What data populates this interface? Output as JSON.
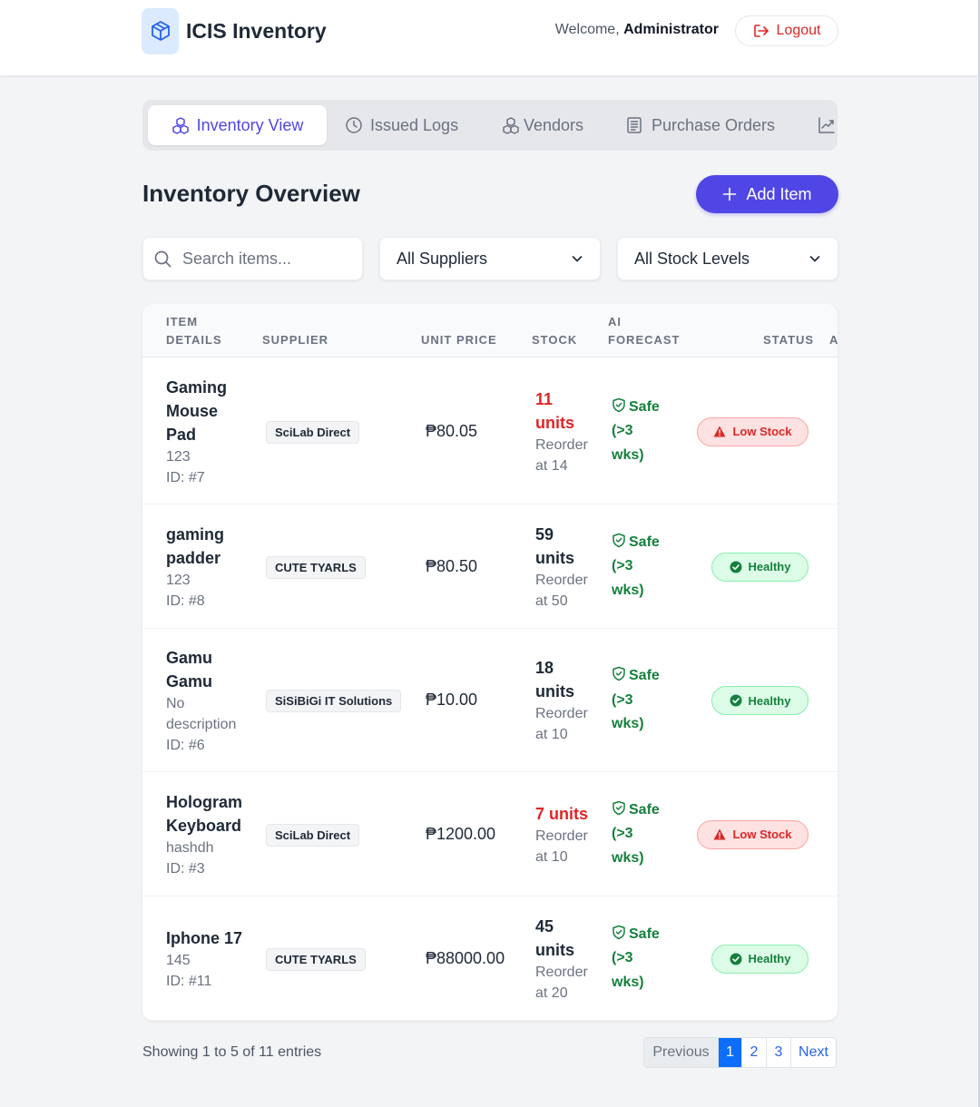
{
  "header": {
    "title": "ICIS Inventory",
    "welcome_prefix": "Welcome,",
    "user": "Administrator",
    "logout_label": "Logout"
  },
  "tabs": [
    {
      "label": "Inventory View",
      "icon": "cubes-icon",
      "active": true
    },
    {
      "label": "Issued Logs",
      "icon": "clock-icon"
    },
    {
      "label": "Vendors",
      "icon": "cubes-icon"
    },
    {
      "label": "Purchase Orders",
      "icon": "document-icon"
    },
    {
      "label": "",
      "icon": "chart-line-icon"
    }
  ],
  "overview": {
    "title": "Inventory Overview",
    "add_label": "Add Item"
  },
  "filters": {
    "search_placeholder": "Search items...",
    "supplier_select": "All Suppliers",
    "stock_select": "All Stock Levels"
  },
  "table": {
    "headers": {
      "item_1": "ITEM",
      "item_2": "DETAILS",
      "supplier": "SUPPLIER",
      "unit_price": "UNIT PRICE",
      "stock": "STOCK",
      "ai_1": "AI",
      "ai_2": "FORECAST",
      "status": "STATUS",
      "actions": "A"
    },
    "rows": [
      {
        "name_lines": [
          "Gaming",
          "Mouse",
          "Pad"
        ],
        "desc_lines": [
          "123"
        ],
        "id": "ID: #7",
        "supplier": "SciLab Direct",
        "price": "₱80.05",
        "stock_lines": [
          "11",
          "units"
        ],
        "stock_low": true,
        "reorder_lines": [
          "Reorder",
          "at 14"
        ],
        "forecast_lines": [
          "Safe",
          "(>3",
          "wks)"
        ],
        "status": "Low Stock",
        "status_kind": "low"
      },
      {
        "name_lines": [
          "gaming",
          "padder"
        ],
        "desc_lines": [
          "123"
        ],
        "id": "ID: #8",
        "supplier": "CUTE TYARLS",
        "price": "₱80.50",
        "stock_lines": [
          "59",
          "units"
        ],
        "stock_low": false,
        "reorder_lines": [
          "Reorder",
          "at 50"
        ],
        "forecast_lines": [
          "Safe",
          "(>3",
          "wks)"
        ],
        "status": "Healthy",
        "status_kind": "ok"
      },
      {
        "name_lines": [
          "Gamu",
          "Gamu"
        ],
        "desc_lines": [
          "No",
          "description"
        ],
        "id": "ID: #6",
        "supplier": "SiSiBiGi IT Solutions",
        "price": "₱10.00",
        "stock_lines": [
          "18",
          "units"
        ],
        "stock_low": false,
        "reorder_lines": [
          "Reorder",
          "at 10"
        ],
        "forecast_lines": [
          "Safe",
          "(>3",
          "wks)"
        ],
        "status": "Healthy",
        "status_kind": "ok"
      },
      {
        "name_lines": [
          "Hologram",
          "Keyboard"
        ],
        "desc_lines": [
          "hashdh"
        ],
        "id": "ID: #3",
        "supplier": "SciLab Direct",
        "price": "₱1200.00",
        "stock_lines": [
          "7 units"
        ],
        "stock_low": true,
        "reorder_lines": [
          "Reorder",
          "at 10"
        ],
        "forecast_lines": [
          "Safe",
          "(>3",
          "wks)"
        ],
        "status": "Low Stock",
        "status_kind": "low"
      },
      {
        "name_lines": [
          "Iphone 17"
        ],
        "desc_lines": [
          "145"
        ],
        "id": "ID: #11",
        "supplier": "CUTE TYARLS",
        "price": "₱88000.00",
        "stock_lines": [
          "45",
          "units"
        ],
        "stock_low": false,
        "reorder_lines": [
          "Reorder",
          "at 20"
        ],
        "forecast_lines": [
          "Safe",
          "(>3",
          "wks)"
        ],
        "status": "Healthy",
        "status_kind": "ok"
      }
    ]
  },
  "footer": {
    "showing": "Showing 1 to 5 of 11 entries",
    "prev": "Previous",
    "pages": [
      "1",
      "2",
      "3"
    ],
    "next": "Next"
  },
  "colors": {
    "accent": "#4f46e5",
    "danger": "#dc2626",
    "success": "#15803d"
  }
}
